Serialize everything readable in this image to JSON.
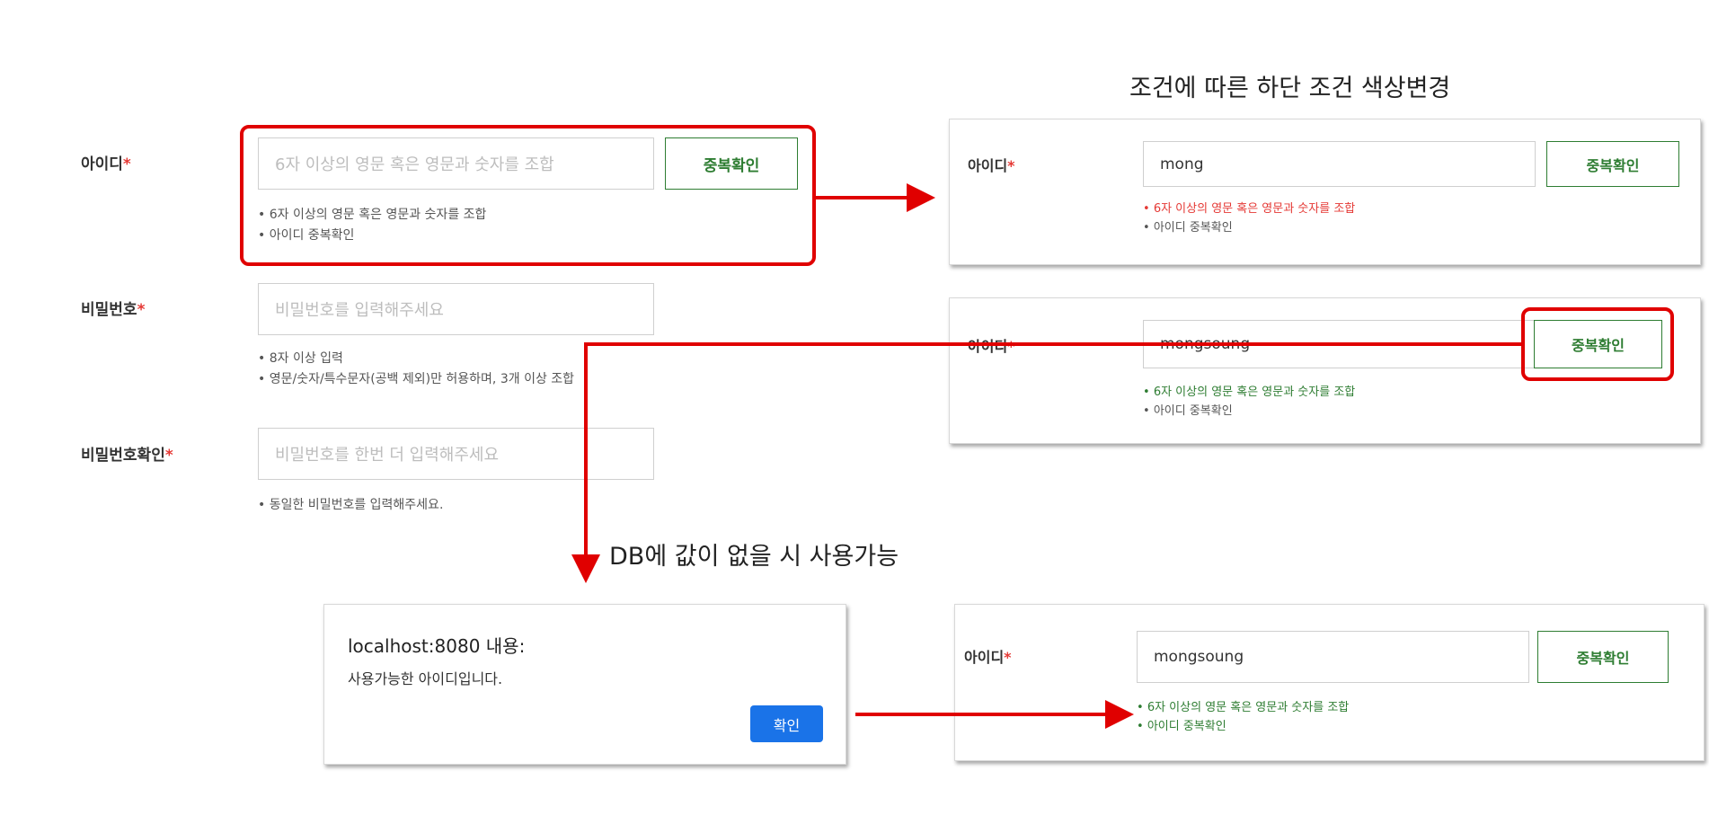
{
  "annotations": {
    "top_right": "조건에 따른 하단 조건 색상변경",
    "middle": "DB에 값이 없을 시 사용가능"
  },
  "form": {
    "id": {
      "label": "아이디",
      "required": "*",
      "placeholder": "6자 이상의 영문 혹은 영문과 숫자를 조합",
      "button": "중복확인",
      "hints": [
        "6자 이상의 영문 혹은 영문과 숫자를 조합",
        "아이디 중복확인"
      ]
    },
    "password": {
      "label": "비밀번호",
      "required": "*",
      "placeholder": "비밀번호를 입력해주세요",
      "hints": [
        "8자 이상 입력",
        "영문/숫자/특수문자(공백 제외)만 허용하며, 3개 이상 조합"
      ]
    },
    "password_confirm": {
      "label": "비밀번호확인",
      "required": "*",
      "placeholder": "비밀번호를 한번 더 입력해주세요",
      "hints": [
        "동일한 비밀번호를 입력해주세요."
      ]
    }
  },
  "examples": {
    "invalid": {
      "label": "아이디",
      "required": "*",
      "value": "mong",
      "button": "중복확인",
      "hints": [
        "6자 이상의 영문 혹은 영문과 숫자를 조합",
        "아이디 중복확인"
      ]
    },
    "valid": {
      "label": "아이디",
      "required": "*",
      "value": "mongsoung",
      "button": "중복확인",
      "hints": [
        "6자 이상의 영문 혹은 영문과 숫자를 조합",
        "아이디 중복확인"
      ]
    },
    "checked": {
      "label": "아이디",
      "required": "*",
      "value": "mongsoung",
      "button": "중복확인",
      "hints": [
        "6자 이상의 영문 혹은 영문과 숫자를 조합",
        "아이디 중복확인"
      ]
    }
  },
  "dialog": {
    "title": "localhost:8080 내용:",
    "message": "사용가능한 아이디입니다.",
    "ok": "확인"
  },
  "colors": {
    "accent_green": "#2e7d32",
    "error_red": "#e53935",
    "annotation_red": "#e00000",
    "dialog_blue": "#1a73e8"
  }
}
